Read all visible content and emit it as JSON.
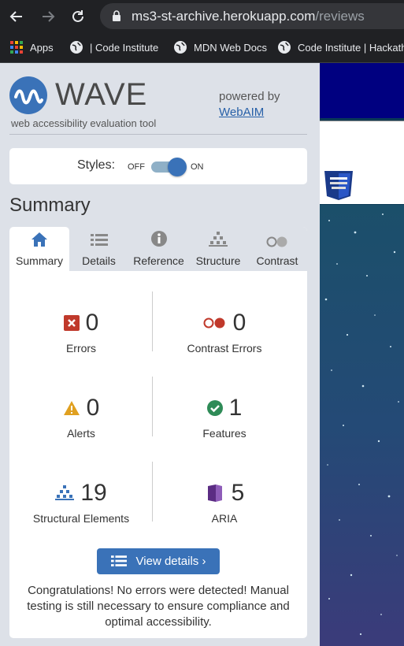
{
  "browser": {
    "url_host": "ms3-st-archive.herokuapp.com",
    "url_path": "/reviews",
    "bookmarks": [
      {
        "label": "Apps",
        "icon": "apps-grid-icon"
      },
      {
        "label": "| Code Institute",
        "icon": "globe-icon"
      },
      {
        "label": "MDN Web Docs",
        "icon": "globe-icon"
      },
      {
        "label": "Code Institute | Hackath...",
        "icon": "globe-icon"
      }
    ]
  },
  "wave": {
    "logo_text": "WAVE",
    "tagline": "web accessibility evaluation tool",
    "powered_by": "powered by",
    "webaim_link": "WebAIM",
    "styles_label": "Styles:",
    "styles_off": "OFF",
    "styles_on": "ON",
    "styles_enabled": true,
    "summary_title": "Summary",
    "tabs": [
      {
        "label": "Summary",
        "icon": "home-icon",
        "active": true
      },
      {
        "label": "Details",
        "icon": "list-icon"
      },
      {
        "label": "Reference",
        "icon": "info-icon"
      },
      {
        "label": "Structure",
        "icon": "structure-icon"
      },
      {
        "label": "Contrast",
        "icon": "contrast-icon"
      }
    ],
    "stats": [
      {
        "label": "Errors",
        "count": "0",
        "icon": "error-icon",
        "color": "#c0392b"
      },
      {
        "label": "Contrast Errors",
        "count": "0",
        "icon": "contrast-error-icon",
        "color": "#c0392b"
      },
      {
        "label": "Alerts",
        "count": "0",
        "icon": "alert-icon",
        "color": "#e0a020"
      },
      {
        "label": "Features",
        "count": "1",
        "icon": "feature-check-icon",
        "color": "#2e8b57"
      },
      {
        "label": "Structural Elements",
        "count": "19",
        "icon": "structure-icon",
        "color": "#3a72b8"
      },
      {
        "label": "ARIA",
        "count": "5",
        "icon": "aria-icon",
        "color": "#5b2c83"
      }
    ],
    "view_details_label": "View details ›",
    "congrats_text": "Congratulations! No errors were detected! Manual testing is still necessary to ensure compliance and optimal accessibility."
  },
  "colors": {
    "accent": "#3a72b8",
    "sidebar_bg": "#dde1e8",
    "page_header": "#000080"
  }
}
